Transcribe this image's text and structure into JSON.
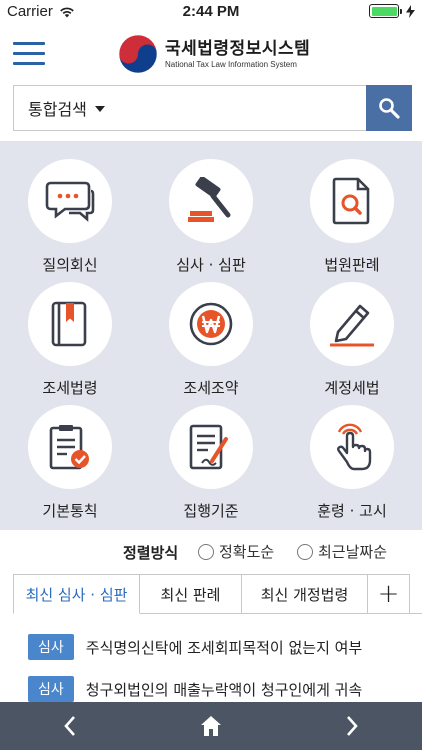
{
  "status_bar": {
    "carrier": "Carrier",
    "time": "2:44 PM",
    "battery_level": 1.0
  },
  "header": {
    "title": "국세법령정보시스템",
    "subtitle": "National Tax Law Information System"
  },
  "search": {
    "category": "통합검색",
    "placeholder": ""
  },
  "grid": {
    "items": [
      {
        "label": "질의회신",
        "icon": "chat-bubbles-icon"
      },
      {
        "label": "심사 · 심판",
        "icon": "gavel-icon"
      },
      {
        "label": "법원판례",
        "icon": "document-search-icon"
      },
      {
        "label": "조세법령",
        "icon": "law-book-icon"
      },
      {
        "label": "조세조약",
        "icon": "won-coin-icon"
      },
      {
        "label": "계정세법",
        "icon": "pencil-icon"
      },
      {
        "label": "기본통칙",
        "icon": "clipboard-check-icon"
      },
      {
        "label": "집행기준",
        "icon": "document-pen-icon"
      },
      {
        "label": "훈령 · 고시",
        "icon": "tap-hand-icon"
      }
    ]
  },
  "sort": {
    "title": "정렬방식",
    "options": [
      "정확도순",
      "최근날짜순"
    ]
  },
  "tabs": {
    "items": [
      "최신 심사 · 심판",
      "최신 판례",
      "최신 개정법령"
    ],
    "active": 0,
    "add": "+"
  },
  "list": {
    "items": [
      {
        "badge": "심사",
        "text": "주식명의신탁에 조세회피목적이 없는지 여부"
      },
      {
        "badge": "심사",
        "text": "청구외법인의 매출누락액이 청구인에게 귀속"
      }
    ]
  },
  "colors": {
    "accent": "#2a6bbd",
    "grid_bg": "#e1e4ec",
    "nav_bg": "#4c5564",
    "icon_orange": "#e8542a",
    "icon_dark": "#3a3f4b"
  }
}
